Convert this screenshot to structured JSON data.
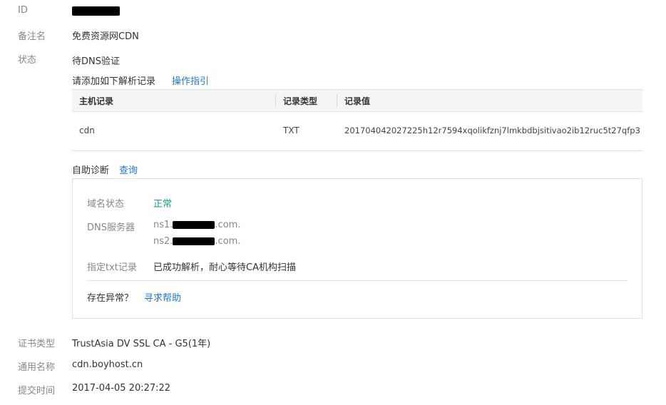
{
  "fields": {
    "id": {
      "label": "ID"
    },
    "remark": {
      "label": "备注名",
      "value": "免费资源网CDN"
    },
    "status": {
      "label": "状态",
      "value": "待DNS验证",
      "instruction": "请添加如下解析记录",
      "guide_link": "操作指引"
    },
    "cert_type": {
      "label": "证书类型",
      "value": "TrustAsia DV SSL CA - G5(1年)"
    },
    "common_name": {
      "label": "通用名称",
      "value": "cdn.boyhost.cn"
    },
    "submit_time": {
      "label": "提交时间",
      "value": "2017-04-05 20:27:22"
    }
  },
  "dns_table": {
    "columns": [
      "主机记录",
      "记录类型",
      "记录值"
    ],
    "rows": [
      [
        "cdn",
        "TXT",
        "201704042027225h12r7594xqolikfznj7lmkbdbjsitivao2ib12ruc5t27qfp3"
      ]
    ]
  },
  "diagnosis": {
    "title": "自助诊断",
    "query_link": "查询",
    "domain_status": {
      "label": "域名状态",
      "value": "正常"
    },
    "dns_servers": {
      "label": "DNS服务器",
      "ns1_prefix": "ns1.",
      "ns1_suffix": ".com.",
      "ns2_prefix": "ns2.",
      "ns2_suffix": ".com."
    },
    "txt_record": {
      "label": "指定txt记录",
      "value": "已成功解析，耐心等待CA机构扫描"
    },
    "help_question": "存在异常？",
    "help_link": "寻求帮助"
  },
  "colors": {
    "link": "#2277d6",
    "ok": "#16a085",
    "label": "#888888"
  }
}
